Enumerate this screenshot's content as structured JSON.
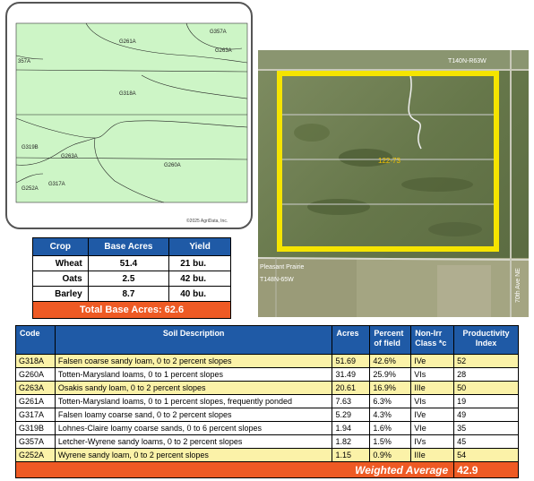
{
  "soil_map": {
    "labels": [
      "G357A",
      "G261A",
      "G263A",
      "357A",
      "G318A",
      "G319B",
      "G263A",
      "G260A",
      "G252A",
      "G317A"
    ],
    "copyright": "©2025 AgriData, Inc.",
    "fill_color": "#cdf5c6"
  },
  "aerial": {
    "top_label": "T140N-R63W",
    "field_label": "122-73",
    "road_label": "Pleasant Prairie",
    "township_label": "T148N-65W",
    "right_label": "70th Ave NE",
    "boundary_color": "#f5e400"
  },
  "crop_table": {
    "headers": [
      "Crop",
      "Base Acres",
      "Yield"
    ],
    "rows": [
      {
        "crop": "Wheat",
        "acres": "51.4",
        "yield": "21  bu."
      },
      {
        "crop": "Oats",
        "acres": "2.5",
        "yield": "42 bu."
      },
      {
        "crop": "Barley",
        "acres": "8.7",
        "yield": "40 bu."
      }
    ],
    "total_label": "Total Base Acres:",
    "total_value": "62.6"
  },
  "soil_table": {
    "headers": {
      "code": "Code",
      "desc": "Soil Description",
      "acres": "Acres",
      "pct": "Percent of field",
      "class": "Non-Irr Class *c",
      "pi": "Productivity Index"
    },
    "rows": [
      {
        "code": "G318A",
        "desc": "Falsen coarse sandy loam, 0 to 2 percent slopes",
        "acres": "51.69",
        "pct": "42.6%",
        "class": "IVe",
        "pi": "52"
      },
      {
        "code": "G260A",
        "desc": "Totten-Marysland loams, 0 to 1 percent slopes",
        "acres": "31.49",
        "pct": "25.9%",
        "class": "VIs",
        "pi": "28"
      },
      {
        "code": "G263A",
        "desc": "Osakis sandy loam, 0 to 2 percent slopes",
        "acres": "20.61",
        "pct": "16.9%",
        "class": "IIIe",
        "pi": "50"
      },
      {
        "code": "G261A",
        "desc": "Totten-Marysland loams, 0 to 1 percent slopes, frequently ponded",
        "acres": "7.63",
        "pct": "6.3%",
        "class": "VIs",
        "pi": "19"
      },
      {
        "code": "G317A",
        "desc": "Falsen loamy coarse sand, 0 to 2 percent slopes",
        "acres": "5.29",
        "pct": "4.3%",
        "class": "IVe",
        "pi": "49"
      },
      {
        "code": "G319B",
        "desc": "Lohnes-Claire loamy coarse sands, 0 to 6 percent slopes",
        "acres": "1.94",
        "pct": "1.6%",
        "class": "VIe",
        "pi": "35"
      },
      {
        "code": "G357A",
        "desc": "Letcher-Wyrene sandy loams, 0 to 2 percent slopes",
        "acres": "1.82",
        "pct": "1.5%",
        "class": "IVs",
        "pi": "45"
      },
      {
        "code": "G252A",
        "desc": "Wyrene sandy loam, 0 to 2 percent slopes",
        "acres": "1.15",
        "pct": "0.9%",
        "class": "IIIe",
        "pi": "54"
      }
    ],
    "weighted_label": "Weighted Average",
    "weighted_value": "42.9"
  }
}
